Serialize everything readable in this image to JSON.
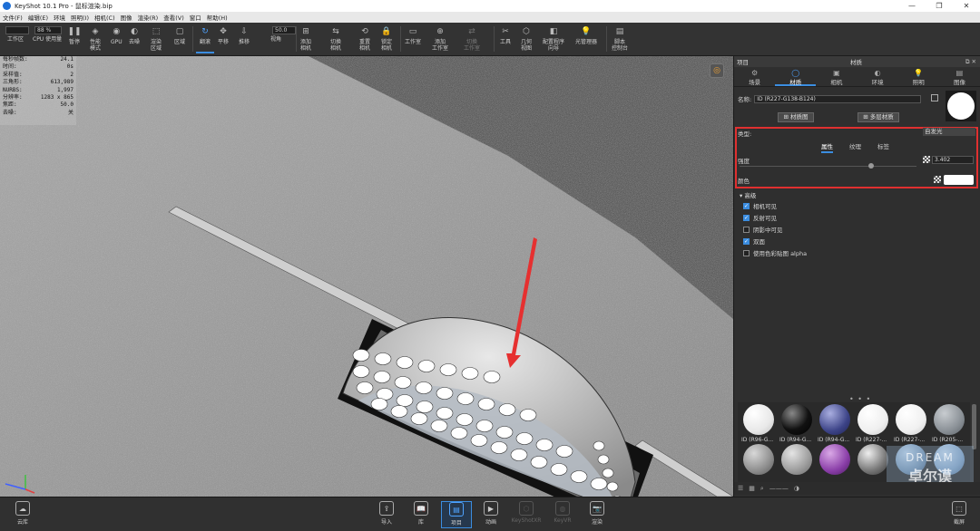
{
  "app": {
    "title": "KeyShot 10.1 Pro  - 鼠标渲染.bip",
    "window_controls": [
      "—",
      "❐",
      "✕"
    ]
  },
  "menu": [
    "文件(F)",
    "编辑(E)",
    "环境",
    "照明(I)",
    "相机(C)",
    "图像",
    "渲染(R)",
    "查看(V)",
    "窗口",
    "帮助(H)"
  ],
  "toolbar": {
    "zoom_value": "88 %",
    "fov_value": "50.0",
    "buttons": [
      {
        "label": "工作区",
        "icon": "□"
      },
      {
        "label": "CPU 使用量",
        "icon": "▣"
      },
      {
        "label": "暂停",
        "icon": "❚❚"
      },
      {
        "label": "性能\n模式",
        "icon": "◈"
      },
      {
        "label": "GPU",
        "icon": "◉"
      },
      {
        "label": "去噪",
        "icon": "◐"
      },
      {
        "label": "渲染\n区域",
        "icon": "⬚"
      },
      {
        "label": "区域",
        "icon": "▢"
      },
      {
        "label": "翻滚",
        "icon": "↻"
      },
      {
        "label": "平移",
        "icon": "✥"
      },
      {
        "label": "推移",
        "icon": "⇩"
      },
      {
        "label": "视角",
        "icon": "◎"
      },
      {
        "label": "添加\n相机",
        "icon": "⊞"
      },
      {
        "label": "切换\n相机",
        "icon": "⇆"
      },
      {
        "label": "重置\n相机",
        "icon": "⟲"
      },
      {
        "label": "锁定\n相机",
        "icon": "🔒"
      },
      {
        "label": "工作室",
        "icon": "▭"
      },
      {
        "label": "添加\n工作室",
        "icon": "⊕"
      },
      {
        "label": "切换\n工作室",
        "icon": "⇄"
      },
      {
        "label": "工具",
        "icon": "✂"
      },
      {
        "label": "几何\n视图",
        "icon": "⬡"
      },
      {
        "label": "配置程序\n向导",
        "icon": "◧"
      },
      {
        "label": "光管理器",
        "icon": "💡"
      },
      {
        "label": "脚本\n控制台",
        "icon": "▤"
      }
    ]
  },
  "stats": [
    {
      "k": "每秒帧数:",
      "v": "24.1"
    },
    {
      "k": "时间:",
      "v": "0s"
    },
    {
      "k": "采样值:",
      "v": "2"
    },
    {
      "k": "三角形:",
      "v": "613,989"
    },
    {
      "k": "NURBS:",
      "v": "1,997"
    },
    {
      "k": "分辨率:",
      "v": "1283 x 865"
    },
    {
      "k": "焦距:",
      "v": "50.0"
    },
    {
      "k": "去噪:",
      "v": "关"
    }
  ],
  "panel": {
    "header_left": "项目",
    "header_center": "材质",
    "header_controls": "⧉ ✕",
    "tabs": [
      {
        "label": "场景",
        "icon": "⚙"
      },
      {
        "label": "材质",
        "icon": "◯"
      },
      {
        "label": "相机",
        "icon": "▣"
      },
      {
        "label": "环境",
        "icon": "◐"
      },
      {
        "label": "照明",
        "icon": "💡"
      },
      {
        "label": "图像",
        "icon": "▤"
      }
    ],
    "name_label": "名称:",
    "name_value": "ID (R227-G138-B124)",
    "material_graph_btn": "⊞ 材质图",
    "multi_material_btn": "⊞ 多层材质",
    "type_label": "类型:",
    "type_value": "自发光",
    "subtabs": [
      "属性",
      "纹理",
      "标签"
    ],
    "intensity_label": "强度",
    "intensity_value": "3.402",
    "color_label": "颜色",
    "advanced_label": "▾ 高级",
    "checkboxes": [
      {
        "label": "相机可见",
        "checked": true
      },
      {
        "label": "反射可见",
        "checked": true
      },
      {
        "label": "阴影中可见",
        "checked": false
      },
      {
        "label": "双面",
        "checked": true
      },
      {
        "label": "使用色彩贴图 alpha",
        "checked": false
      }
    ],
    "more_dots": "• • •",
    "library": [
      {
        "label": "",
        "color": "radial-gradient(circle at 35% 30%, #ffffff, #e8e8e8 60%, #bdbdbd)"
      },
      {
        "label": "",
        "color": "radial-gradient(circle at 35% 30%, #888, #111 55%, #000)"
      },
      {
        "label": "",
        "color": "radial-gradient(circle at 35% 30%, #a9aee0, #3d4488 60%, #1e2250)"
      },
      {
        "label": "",
        "color": "radial-gradient(circle at 35% 30%, #ffffff, #efefef 60%, #c8c8c8)"
      },
      {
        "label": "",
        "color": "radial-gradient(circle at 35% 30%, #ffffff, #f0f0f0 60%, #cacaca)"
      },
      {
        "label": "",
        "color": "radial-gradient(circle at 35% 30%, #c8ccd0, #8a9096 60%, #5a6066)"
      },
      {
        "label": "ID (R96-G...",
        "color": "radial-gradient(circle at 35% 30%, #d8d8d8, #8e8e8e 60%, #555)"
      },
      {
        "label": "ID (R94-G...",
        "color": "radial-gradient(circle at 35% 30%, #e4e4e4, #9c9c9c 60%, #666)"
      },
      {
        "label": "ID (R94-G...",
        "color": "radial-gradient(circle at 35% 30%, #d9a8e6, #8a3ea8 60%, #4a1a60)"
      },
      {
        "label": "ID (R227-...",
        "color": "radial-gradient(circle at 35% 30%, #eee, #777 60%, #333)"
      },
      {
        "label": "ID (R227-...",
        "color": "radial-gradient(circle at 35% 30%, #b8d0e8, #7090b0 60%, #405878)"
      },
      {
        "label": "ID (R205-...",
        "color": "radial-gradient(circle at 35% 30%, #c0d6ec, #7ea0c4 60%, #4a6a8c)"
      }
    ],
    "lib_tools": [
      "☰",
      "▦",
      "⌕",
      "———",
      "◑"
    ]
  },
  "watermark": {
    "line1": "DREAM",
    "line2": "卓尔谟"
  },
  "bottombar": [
    {
      "label": "云库",
      "icon": "☁"
    },
    {
      "label": "导入",
      "icon": "⇪"
    },
    {
      "label": "库",
      "icon": "📖"
    },
    {
      "label": "项目",
      "icon": "▤"
    },
    {
      "label": "动画",
      "icon": "▶"
    },
    {
      "label": "KeyShotXR",
      "icon": "⬡"
    },
    {
      "label": "KeyVR",
      "icon": "◍"
    },
    {
      "label": "渲染",
      "icon": "📷"
    },
    {
      "label": "截屏",
      "icon": "⬚"
    }
  ]
}
